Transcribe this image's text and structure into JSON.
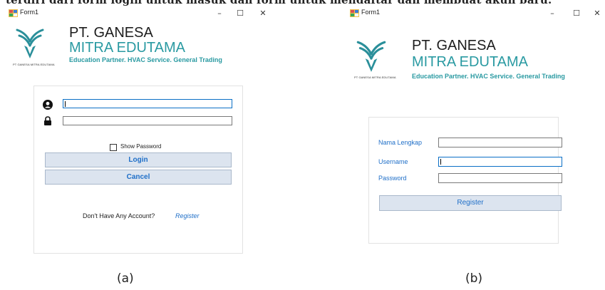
{
  "page_fragment_text": "terdiri dari form login untuk masuk dan form untuk mendaftar dan membuat akun baru.",
  "brand": {
    "accent_teal": "#2a9aa2",
    "link_blue": "#1f6fc8",
    "button_bg": "#dce4ef",
    "focus_border": "#0b6fc6"
  },
  "window_a": {
    "title": "Form1",
    "controls": {
      "minimize": "–",
      "maximize": "☐",
      "close": "✕"
    },
    "logo_caption": "PT GANESA MITRA EDUTAMA",
    "company_name": "PT. GANESA",
    "company_sub": "MITRA EDUTAMA",
    "tagline": "Education Partner. HVAC Service. General Trading",
    "login_form": {
      "username_icon": "user-icon",
      "password_icon": "lock-icon",
      "username_value": "",
      "password_value": "",
      "show_password_label": "Show Password",
      "show_password_checked": false,
      "login_label": "Login",
      "cancel_label": "Cancel",
      "no_account_text": "Don't Have Any Account?",
      "register_link": "Register"
    },
    "caption": "(a)"
  },
  "window_b": {
    "title": "Form1",
    "controls": {
      "minimize": "–",
      "maximize": "☐",
      "close": "✕"
    },
    "logo_caption": "PT GANESA MITRA EDUTAMA",
    "company_name": "PT. GANESA",
    "company_sub": "MITRA EDUTAMA",
    "tagline": "Education Partner. HVAC Service. General Trading",
    "register_form": {
      "name_label": "Nama Lengkap",
      "username_label": "Username",
      "password_label": "Password",
      "name_value": "",
      "username_value": "",
      "password_value": "",
      "register_label": "Register"
    },
    "caption": "(b)"
  }
}
